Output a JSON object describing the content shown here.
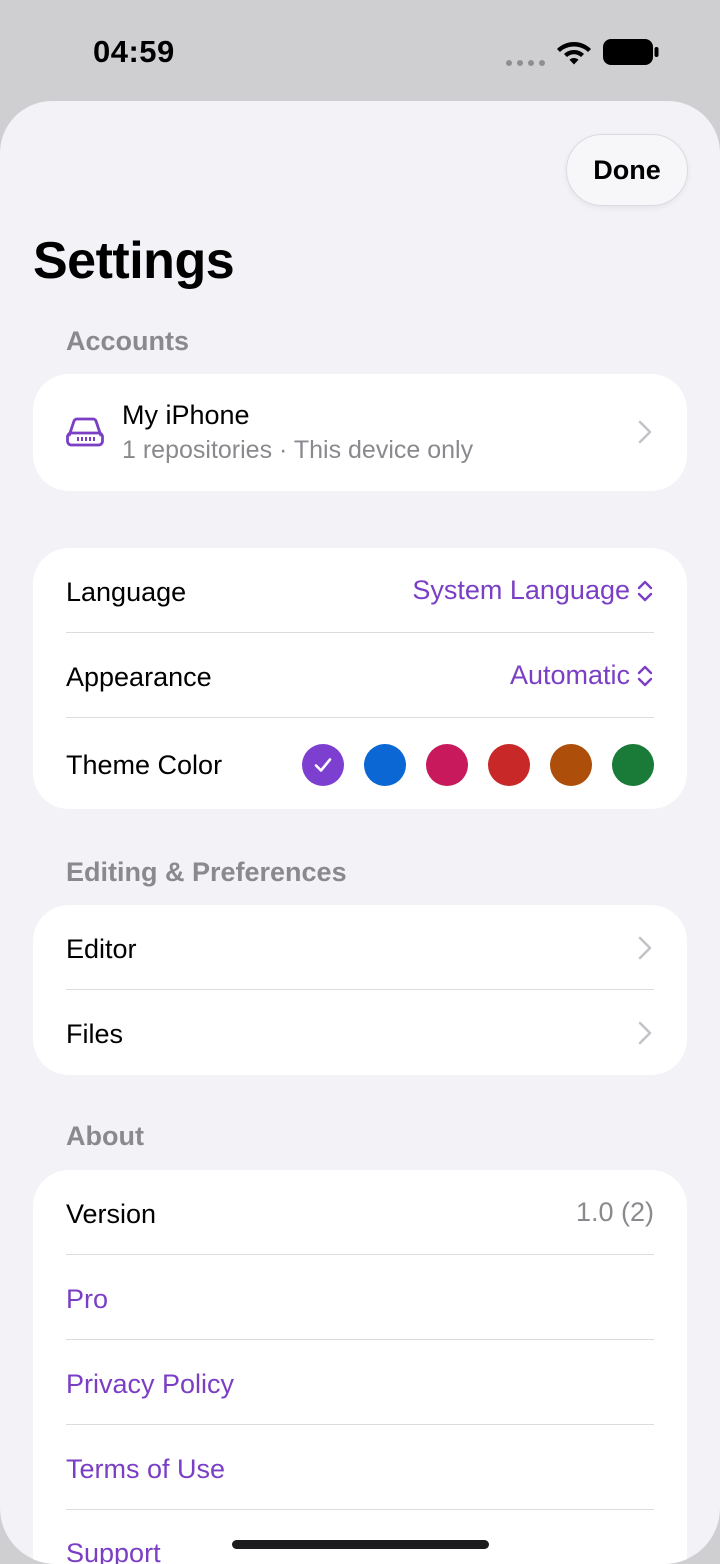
{
  "status_bar": {
    "time": "04:59",
    "icons": [
      "cellular-dots-icon",
      "wifi-icon",
      "battery-icon"
    ]
  },
  "header": {
    "done_label": "Done",
    "title": "Settings"
  },
  "accounts": {
    "header": "Accounts",
    "item": {
      "icon": "drive-icon",
      "title": "My iPhone",
      "subtitle": "1 repositories · This device only"
    }
  },
  "appearance_group": {
    "language": {
      "label": "Language",
      "value": "System Language"
    },
    "appearance": {
      "label": "Appearance",
      "value": "Automatic"
    },
    "theme": {
      "label": "Theme Color",
      "colors": [
        "#7c3fcf",
        "#0a67d4",
        "#c8195d",
        "#c82828",
        "#ad4e0a",
        "#1a7a38"
      ],
      "selected_index": 0
    }
  },
  "editing": {
    "header": "Editing & Preferences",
    "items": [
      {
        "label": "Editor"
      },
      {
        "label": "Files"
      }
    ]
  },
  "about": {
    "header": "About",
    "version": {
      "label": "Version",
      "value": "1.0 (2)"
    },
    "links": [
      {
        "label": "Pro"
      },
      {
        "label": "Privacy Policy"
      },
      {
        "label": "Terms of Use"
      },
      {
        "label": "Support"
      }
    ]
  },
  "colors": {
    "accent": "#7a3fc4",
    "background": "#f2f2f7",
    "card": "#ffffff",
    "secondary_text": "#8a8a8e"
  }
}
